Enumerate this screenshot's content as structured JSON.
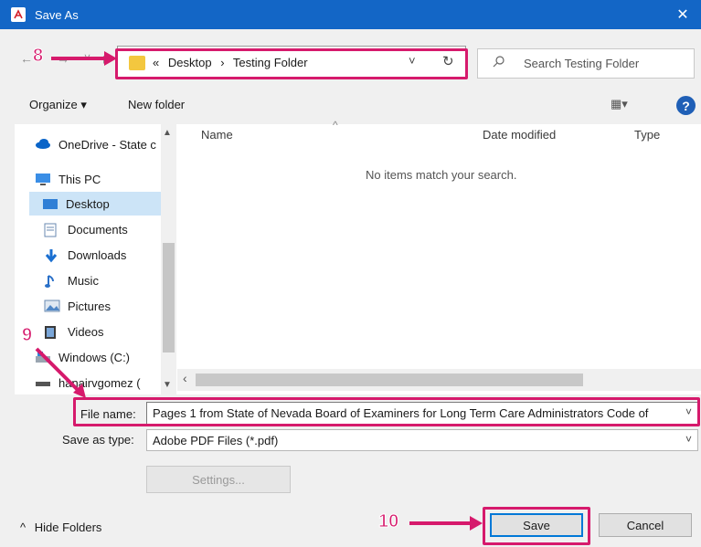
{
  "window": {
    "title": "Save As",
    "close_glyph": "✕"
  },
  "navigation": {
    "back_glyph": "←",
    "forward_glyph": "→",
    "recent_glyph": "˅",
    "up_glyph": "↑",
    "breadcrumb_prefix": "«",
    "breadcrumbs": [
      "Desktop",
      "Testing Folder"
    ],
    "separator": "›",
    "dropdown_glyph": "˅",
    "refresh_glyph": "↻"
  },
  "search": {
    "placeholder": "Search Testing Folder"
  },
  "toolbar": {
    "organize_label": "Organize ▾",
    "new_folder_label": "New folder",
    "view_label": "▦▾",
    "help_label": "?"
  },
  "nav_pane": {
    "items": [
      {
        "label": "OneDrive - State c",
        "icon": "cloud-icon"
      },
      {
        "label": "This PC",
        "icon": "computer-icon"
      },
      {
        "label": "Desktop",
        "icon": "desktop-icon",
        "selected": true
      },
      {
        "label": "Documents",
        "icon": "documents-icon"
      },
      {
        "label": "Downloads",
        "icon": "downloads-icon"
      },
      {
        "label": "Music",
        "icon": "music-icon"
      },
      {
        "label": "Pictures",
        "icon": "pictures-icon"
      },
      {
        "label": "Videos",
        "icon": "videos-icon"
      },
      {
        "label": "Windows (C:)",
        "icon": "drive-icon"
      },
      {
        "label": "hanairvgomez (",
        "icon": "network-drive-icon"
      }
    ]
  },
  "file_list": {
    "columns": [
      "Name",
      "Date modified",
      "Type"
    ],
    "empty_message": "No items match your search."
  },
  "form": {
    "file_name_label": "File name:",
    "file_name_value": "Pages 1 from State of Nevada Board of Examiners for Long Term Care Administrators Code of",
    "save_as_type_label": "Save as type:",
    "save_as_type_value": "Adobe PDF Files (*.pdf)",
    "settings_label": "Settings..."
  },
  "footer": {
    "hide_folders_label": "Hide Folders",
    "save_label": "Save",
    "cancel_label": "Cancel"
  },
  "annotations": {
    "step_8": "8",
    "step_9": "9",
    "step_10": "10",
    "accent_color": "#d61a6c"
  },
  "colors": {
    "title_bar": "#1366c6",
    "selection": "#cce4f7"
  }
}
